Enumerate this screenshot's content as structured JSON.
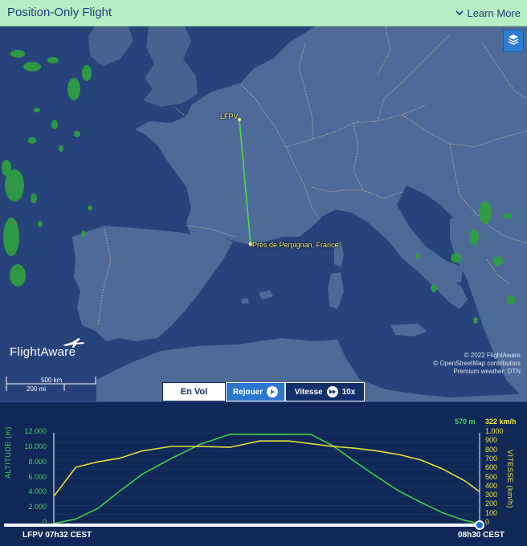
{
  "header": {
    "title": "Position-Only Flight",
    "learn_more": "Learn More",
    "chevron_icon": "chevron-down-icon"
  },
  "map": {
    "layers_icon": "layers-icon",
    "origin_label": "LFPV",
    "destination_label": "Près de Perpignan, France",
    "brand": "FlightAware",
    "scale_km": "500 km",
    "scale_mi": "200 mi",
    "credits": [
      "© 2022 FlightAware",
      "© OpenStreetMap contributors",
      "Premium weather: DTN"
    ],
    "controls": {
      "en_vol": "En Vol",
      "rejouer": "Rejouer",
      "vitesse": "Vitesse",
      "vitesse_value": "10x"
    },
    "colors": {
      "land": "#4e6b98",
      "water": "#26437a",
      "route": "#4cd64c",
      "weather": "#37b04a"
    }
  },
  "profile": {
    "altitude_readout": "570 m",
    "speed_readout": "322 km/h",
    "altitude_axis_label": "ALTITUDE (m)",
    "speed_axis_label": "VITESSE (km/h)",
    "altitude_ticks": [
      "12.000",
      "10.000",
      "8.000",
      "6.000",
      "4.000",
      "2.000",
      "0"
    ],
    "speed_ticks": [
      "1.000",
      "900",
      "800",
      "700",
      "600",
      "500",
      "400",
      "300",
      "200",
      "100",
      "0"
    ],
    "start_label": "LFPV 07h32 CEST",
    "end_label": "08h30 CEST",
    "colors": {
      "altitude": "#3fcf4a",
      "speed": "#e8e23a"
    }
  },
  "chart_data": {
    "type": "line",
    "x_label_start": "LFPV 07h32 CEST",
    "x_label_end": "08h30 CEST",
    "x_minutes": [
      0,
      3,
      6,
      9,
      12,
      16,
      20,
      24,
      28,
      32,
      35,
      38,
      41,
      44,
      47,
      50,
      53,
      56,
      58
    ],
    "series": [
      {
        "name": "ALTITUDE (m)",
        "axis": "left",
        "ylim": [
          0,
          12000
        ],
        "values": [
          0,
          600,
          2000,
          4300,
          6500,
          8600,
          10500,
          11800,
          11800,
          11800,
          11800,
          10300,
          8200,
          6200,
          4300,
          2800,
          1400,
          400,
          0
        ]
      },
      {
        "name": "VITESSE (km/h)",
        "axis": "right",
        "ylim": [
          0,
          1000
        ],
        "values": [
          300,
          620,
          680,
          720,
          800,
          850,
          850,
          840,
          910,
          910,
          880,
          850,
          830,
          800,
          760,
          700,
          600,
          470,
          350
        ]
      }
    ]
  }
}
